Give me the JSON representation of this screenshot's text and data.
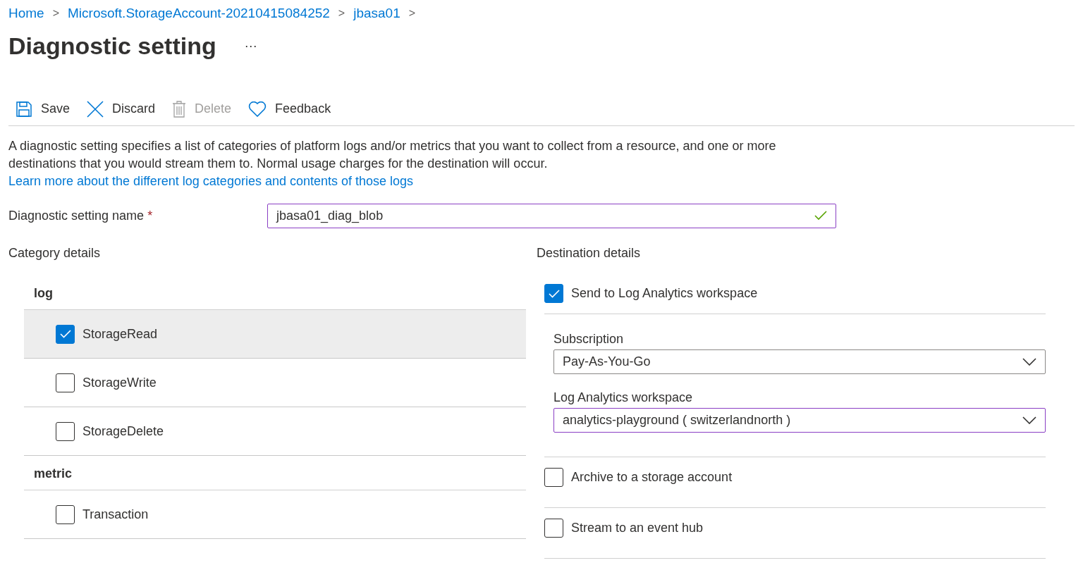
{
  "breadcrumb": [
    {
      "label": "Home"
    },
    {
      "label": "Microsoft.StorageAccount-20210415084252"
    },
    {
      "label": "jbasa01"
    }
  ],
  "breadcrumb_separator": ">",
  "title": "Diagnostic setting",
  "more": "···",
  "toolbar": [
    {
      "kind": "save",
      "label": "Save",
      "disabled": false
    },
    {
      "kind": "discard",
      "label": "Discard",
      "disabled": false
    },
    {
      "kind": "delete",
      "label": "Delete",
      "disabled": true
    },
    {
      "kind": "feedback",
      "label": "Feedback",
      "disabled": false
    }
  ],
  "description": {
    "text": "A diagnostic setting specifies a list of categories of platform logs and/or metrics that you want to collect from a resource, and one or more destinations that you would stream them to. Normal usage charges for the destination will occur.",
    "link": "Learn more about the different log categories and contents of those logs"
  },
  "name_field": {
    "label": "Diagnostic setting name",
    "required_mark": "*",
    "value": "jbasa01_diag_blob",
    "valid": true
  },
  "category": {
    "heading": "Category details",
    "groups": [
      {
        "name": "log",
        "items": [
          {
            "label": "StorageRead",
            "checked": true,
            "selected": true
          },
          {
            "label": "StorageWrite",
            "checked": false,
            "selected": false
          },
          {
            "label": "StorageDelete",
            "checked": false,
            "selected": false
          }
        ]
      },
      {
        "name": "metric",
        "items": [
          {
            "label": "Transaction",
            "checked": false,
            "selected": false
          }
        ]
      }
    ]
  },
  "destination": {
    "heading": "Destination details",
    "options": [
      {
        "label": "Send to Log Analytics workspace",
        "checked": true,
        "fields": [
          {
            "label": "Subscription",
            "value": "Pay-As-You-Go",
            "focused": false
          },
          {
            "label": "Log Analytics workspace",
            "value": "analytics-playground ( switzerlandnorth )",
            "focused": true
          }
        ]
      },
      {
        "label": "Archive to a storage account",
        "checked": false
      },
      {
        "label": "Stream to an event hub",
        "checked": false
      }
    ]
  }
}
